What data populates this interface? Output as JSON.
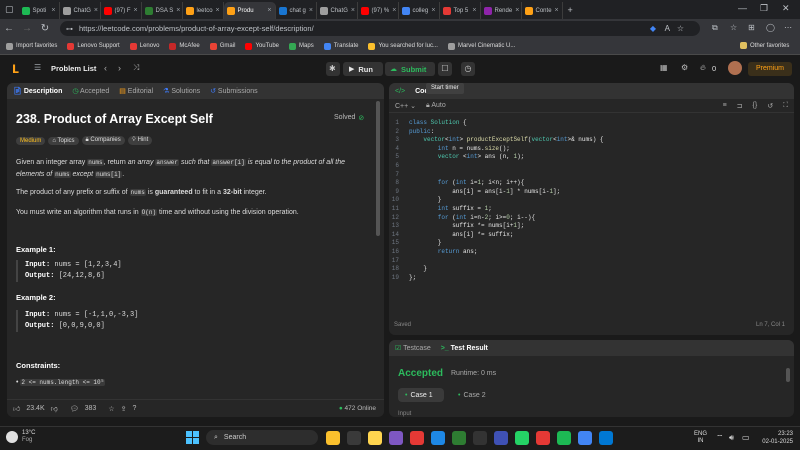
{
  "browser": {
    "tabs": [
      {
        "label": "Spoti",
        "color": "#1db954"
      },
      {
        "label": "ChatG",
        "color": "#9e9e9e"
      },
      {
        "label": "(97) F",
        "color": "#ff0000"
      },
      {
        "label": "DSA S",
        "color": "#2e7d32"
      },
      {
        "label": "leetco",
        "color": "#ffa116"
      },
      {
        "label": "Produ",
        "color": "#ffa116"
      },
      {
        "label": "chat g",
        "color": "#1976d2"
      },
      {
        "label": "ChatG",
        "color": "#9e9e9e"
      },
      {
        "label": "(97) %",
        "color": "#ff0000"
      },
      {
        "label": "colleg",
        "color": "#4285f4"
      },
      {
        "label": "Top 5",
        "color": "#e53935"
      },
      {
        "label": "Rende",
        "color": "#8e24aa"
      },
      {
        "label": "Conte",
        "color": "#ffa116"
      }
    ],
    "active_tab_index": 5,
    "url": "https://leetcode.com/problems/product-of-array-except-self/description/",
    "bookmarks": [
      {
        "label": "Import favorites",
        "color": "#9e9e9e"
      },
      {
        "label": "Lenovo Support",
        "color": "#e53935"
      },
      {
        "label": "Lenovo",
        "color": "#e53935"
      },
      {
        "label": "McAfee",
        "color": "#c62828"
      },
      {
        "label": "Gmail",
        "color": "#ea4335"
      },
      {
        "label": "YouTube",
        "color": "#ff0000"
      },
      {
        "label": "Maps",
        "color": "#34a853"
      },
      {
        "label": "Translate",
        "color": "#4285f4"
      },
      {
        "label": "You searched for luc...",
        "color": "#fbc02d"
      },
      {
        "label": "Marvel Cinematic U...",
        "color": "#9e9e9e"
      }
    ],
    "other_favorites": "Other favorites"
  },
  "lc": {
    "problem_list": "Problem List",
    "run": "Run",
    "submit": "Submit",
    "notif_count": "0",
    "premium": "Premium"
  },
  "left": {
    "tabs": [
      "Description",
      "Accepted",
      "Editorial",
      "Solutions",
      "Submissions"
    ],
    "title": "238. Product of Array Except Self",
    "solved": "Solved",
    "difficulty": "Medium",
    "chips": [
      "Topics",
      "Companies",
      "Hint"
    ],
    "desc": {
      "p1a": "Given an integer array",
      "p1code1": "nums",
      "p1b": ", return",
      "p1c": "an array",
      "p1code2": "answer",
      "p1d": "such that",
      "p1code3": "answer[i]",
      "p1e": "is equal to the product of all the",
      "p1f": "elements of",
      "p1code4": "nums",
      "p1g": "except",
      "p1code5": "nums[i]",
      "p2a": "The product of any prefix or suffix of",
      "p2code": "nums",
      "p2b": "is",
      "p2c": "guaranteed",
      "p2d": "to fit in a",
      "p2e": "32-bit",
      "p2f": "integer.",
      "p3a": "You must write an algorithm that runs in",
      "p3code": "O(n)",
      "p3b": "time and without using the division operation."
    },
    "ex1_title": "Example 1:",
    "ex1_input_label": "Input:",
    "ex1_input": "nums = [1,2,3,4]",
    "ex1_output_label": "Output:",
    "ex1_output": "[24,12,8,6]",
    "ex2_title": "Example 2:",
    "ex2_input_label": "Input:",
    "ex2_input": "nums = [-1,1,0,-3,3]",
    "ex2_output_label": "Output:",
    "ex2_output": "[0,0,9,0,0]",
    "constraints_title": "Constraints:",
    "constraint1": "2 <= nums.length <= 10⁵",
    "likes": "23.4K",
    "comments": "383",
    "online": "472 Online"
  },
  "code": {
    "tab": "Code",
    "tooltip": "Start timer",
    "language": "C++",
    "auto": "Auto",
    "lines": [
      [
        [
          "class ",
          "kw"
        ],
        [
          "Solution",
          "ty"
        ],
        [
          " {",
          ""
        ]
      ],
      [
        [
          "public",
          "kw"
        ],
        [
          ":",
          ""
        ]
      ],
      [
        [
          "    vector",
          "ty"
        ],
        [
          "<",
          ""
        ],
        [
          "int",
          "kw"
        ],
        [
          "> ",
          ""
        ],
        [
          "productExceptSelf",
          "fn"
        ],
        [
          "(",
          ""
        ],
        [
          "vector",
          "ty"
        ],
        [
          "<",
          ""
        ],
        [
          "int",
          "kw"
        ],
        [
          ">& nums) {",
          ""
        ]
      ],
      [
        [
          "        int",
          "kw"
        ],
        [
          " n = nums.",
          ""
        ],
        [
          "size",
          "fn"
        ],
        [
          "();",
          ""
        ]
      ],
      [
        [
          "        vector",
          "ty"
        ],
        [
          " <",
          ""
        ],
        [
          "int",
          "kw"
        ],
        [
          "> ans (n, ",
          ""
        ],
        [
          "1",
          "num"
        ],
        [
          ");",
          ""
        ]
      ],
      [
        [
          "",
          ""
        ]
      ],
      [
        [
          "",
          ""
        ]
      ],
      [
        [
          "        for",
          "kw"
        ],
        [
          " (",
          ""
        ],
        [
          "int",
          "kw"
        ],
        [
          " i=",
          ""
        ],
        [
          "1",
          "num"
        ],
        [
          "; i<n; i++){",
          ""
        ]
      ],
      [
        [
          "            ans[i] = ans[i-",
          ""
        ],
        [
          "1",
          "num"
        ],
        [
          "] * nums[i-",
          ""
        ],
        [
          "1",
          "num"
        ],
        [
          "];",
          ""
        ]
      ],
      [
        [
          "        }",
          ""
        ]
      ],
      [
        [
          "        int",
          "kw"
        ],
        [
          " suffix = ",
          ""
        ],
        [
          "1",
          "num"
        ],
        [
          ";",
          ""
        ]
      ],
      [
        [
          "        for",
          "kw"
        ],
        [
          " (",
          ""
        ],
        [
          "int",
          "kw"
        ],
        [
          " i=n-",
          ""
        ],
        [
          "2",
          "num"
        ],
        [
          "; i>=",
          ""
        ],
        [
          "0",
          "num"
        ],
        [
          "; i--){",
          ""
        ]
      ],
      [
        [
          "            suffix *= nums[i+",
          ""
        ],
        [
          "1",
          "num"
        ],
        [
          "];",
          ""
        ]
      ],
      [
        [
          "            ans[i] *= suffix;",
          ""
        ]
      ],
      [
        [
          "        }",
          ""
        ]
      ],
      [
        [
          "        return",
          "kw"
        ],
        [
          " ans;",
          ""
        ]
      ],
      [
        [
          "",
          ""
        ]
      ],
      [
        [
          "    }",
          ""
        ]
      ],
      [
        [
          "};",
          ""
        ]
      ]
    ],
    "saved": "Saved",
    "cursor": "Ln 7, Col 1"
  },
  "result": {
    "tab_testcase": "Testcase",
    "tab_result": "Test Result",
    "status": "Accepted",
    "runtime": "Runtime: 0 ms",
    "case1": "Case 1",
    "case2": "Case 2",
    "input_label": "Input"
  },
  "taskbar": {
    "temp": "13°C",
    "weather": "Fog",
    "search": "Search",
    "lang1": "ENG",
    "lang2": "IN",
    "time": "23:23",
    "date": "02-01-2025"
  },
  "colors": {
    "accent_green": "#2cbb5d",
    "lc_orange": "#ffa116",
    "medium_yellow": "#ffc01e",
    "link_blue": "#3e7bfa"
  }
}
